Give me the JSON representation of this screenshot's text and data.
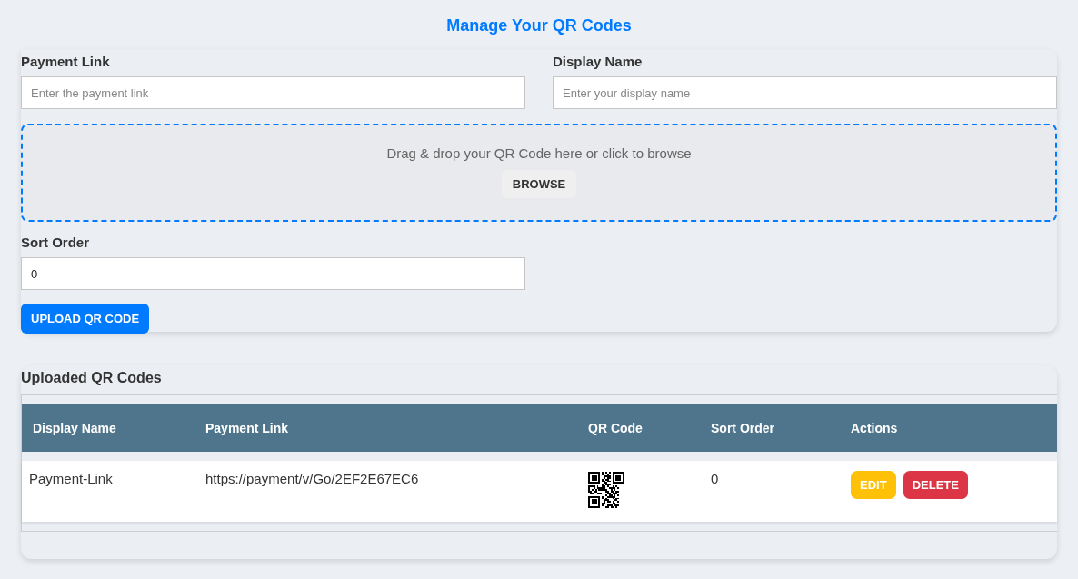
{
  "title": "Manage Your QR Codes",
  "form": {
    "fields": [
      {
        "label": "Payment Link",
        "placeholder": "Enter the payment link"
      },
      {
        "label": "Display Name",
        "placeholder": "Enter your display name"
      }
    ],
    "dropzone": {
      "text": "Drag & drop your QR Code here or click to browse",
      "button": "BROWSE"
    },
    "sort_order": {
      "label": "Sort Order",
      "value": "0"
    },
    "submit": "UPLOAD QR CODE"
  },
  "uploaded": {
    "title": "Uploaded QR Codes",
    "table": {
      "columns": [
        "Display Name",
        "Payment Link",
        "QR Code",
        "Sort Order",
        "Actions"
      ],
      "rows": [
        {
          "display_name": "Payment-Link",
          "payment_link": "https://payment/v/Go/2EF2E67EC6",
          "sort_order": "0",
          "actions": [
            {
              "label": "EDIT",
              "kind": "edit"
            },
            {
              "label": "DELETE",
              "kind": "delete"
            }
          ]
        }
      ]
    }
  }
}
